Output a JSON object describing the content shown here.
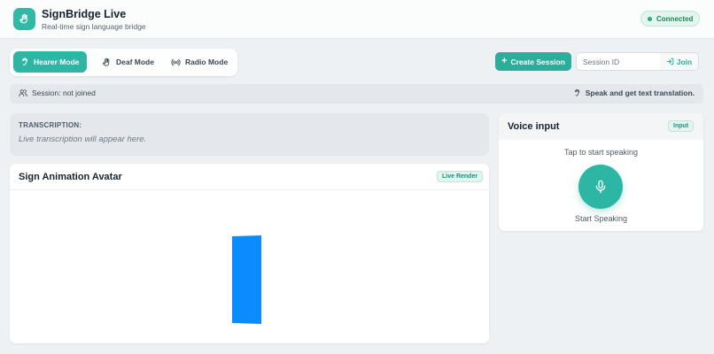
{
  "header": {
    "title": "SignBridge Live",
    "subtitle": "Real-time sign language bridge",
    "status": "Connected",
    "logo_icon": "hand-icon"
  },
  "modes": [
    {
      "label": "Hearer Mode",
      "icon": "ear-icon",
      "active": true
    },
    {
      "label": "Deaf Mode",
      "icon": "hand-icon",
      "active": false
    },
    {
      "label": "Radio Mode",
      "icon": "radio-icon",
      "active": false
    }
  ],
  "session_controls": {
    "create_label": "Create Session",
    "session_placeholder": "Session ID",
    "join_label": "Join"
  },
  "session_strip": {
    "status": "Session: not joined",
    "hint": "Speak and get text translation."
  },
  "transcription": {
    "label": "TRANSCRIPTION:",
    "placeholder": "Live transcription will appear here."
  },
  "avatar": {
    "title": "Sign Animation Avatar",
    "badge": "Live Render",
    "bar_color": "#0a8cff"
  },
  "voice": {
    "title": "Voice input",
    "badge": "Input",
    "hint": "Tap to start speaking",
    "button_label": "Start Speaking"
  },
  "colors": {
    "accent": "#2cb6a3",
    "status_green": "#1fae6b"
  }
}
